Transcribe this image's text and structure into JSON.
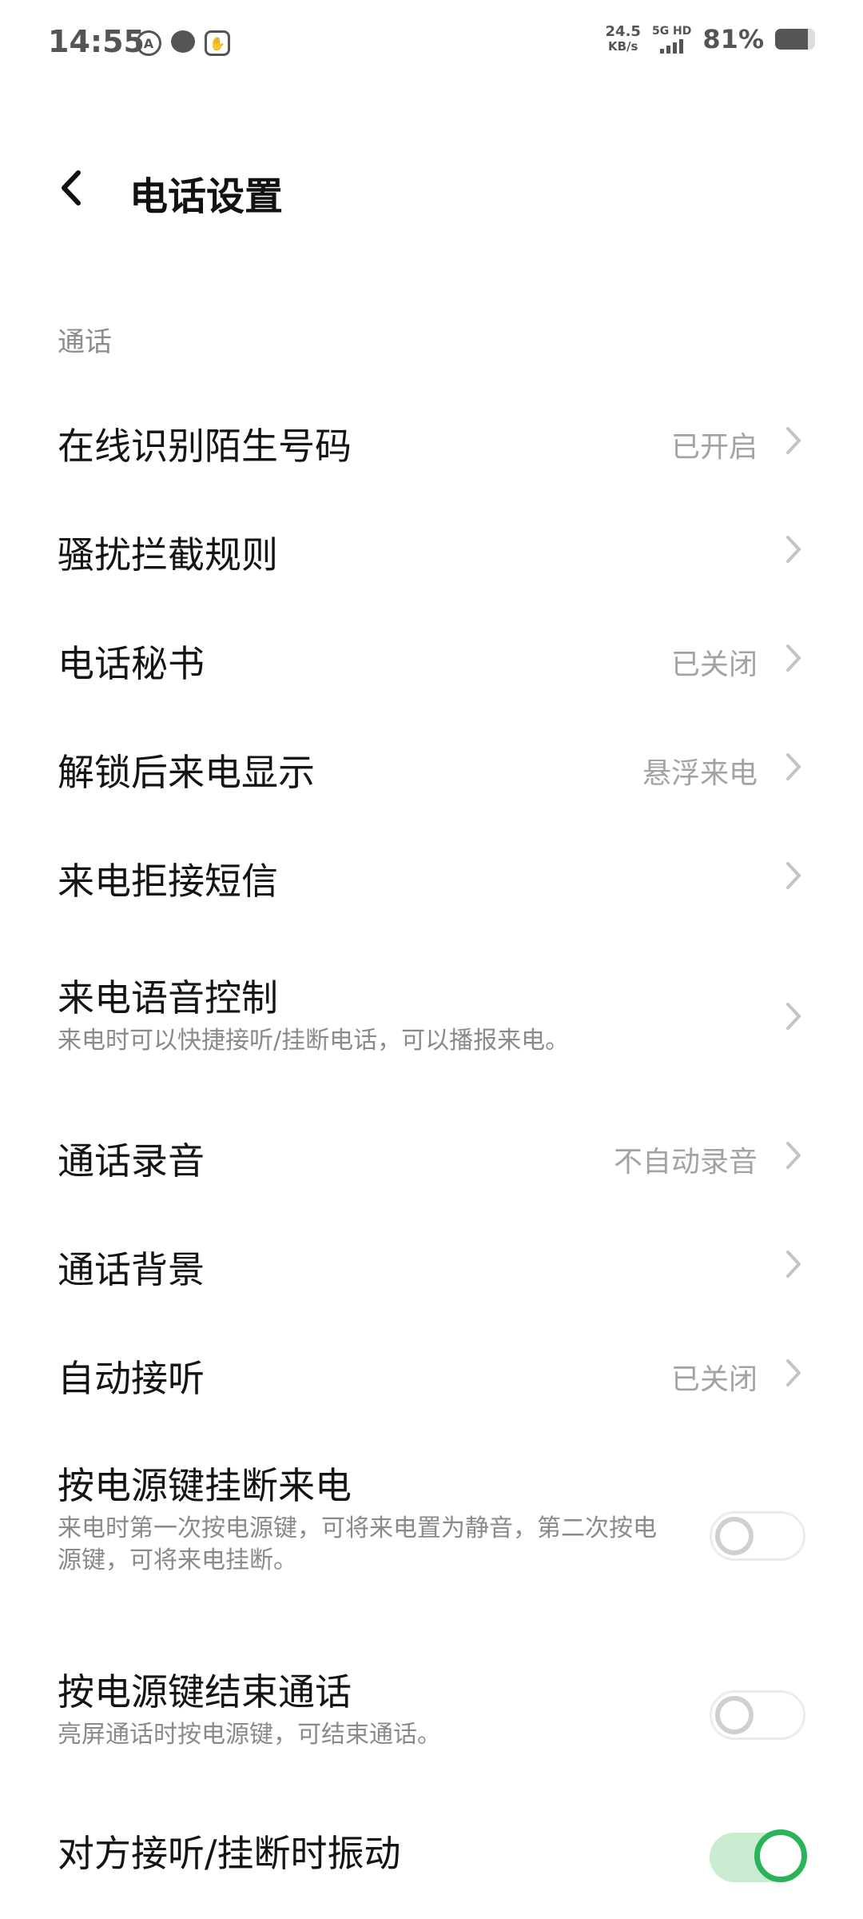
{
  "status_bar": {
    "time": "14:55",
    "left_icons": [
      "accessibility-icon",
      "message-icon",
      "app-icon"
    ],
    "netspeed_value": "24.5",
    "netspeed_unit": "KB/s",
    "network_type": "5G HD",
    "battery_percent_text": "81%",
    "battery_level": 0.81
  },
  "header": {
    "title": "电话设置",
    "back_icon": "chevron-left-icon"
  },
  "section": {
    "label": "通话"
  },
  "rows": [
    {
      "title": "在线识别陌生号码",
      "value": "已开启",
      "type": "nav"
    },
    {
      "title": "骚扰拦截规则",
      "value": "",
      "type": "nav"
    },
    {
      "title": "电话秘书",
      "value": "已关闭",
      "type": "nav"
    },
    {
      "title": "解锁后来电显示",
      "value": "悬浮来电",
      "type": "nav"
    },
    {
      "title": "来电拒接短信",
      "value": "",
      "type": "nav"
    },
    {
      "title": "来电语音控制",
      "subtitle": "来电时可以快捷接听/挂断电话，可以播报来电。",
      "type": "nav"
    },
    {
      "title": "通话录音",
      "value": "不自动录音",
      "type": "nav"
    },
    {
      "title": "通话背景",
      "value": "",
      "type": "nav"
    },
    {
      "title": "自动接听",
      "value": "已关闭",
      "type": "nav"
    },
    {
      "title": "按电源键挂断来电",
      "subtitle": "来电时第一次按电源键，可将来电置为静音，第二次按电源键，可将来电挂断。",
      "type": "toggle",
      "on": false
    },
    {
      "title": "按电源键结束通话",
      "subtitle": "亮屏通话时按电源键，可结束通话。",
      "type": "toggle",
      "on": false
    },
    {
      "title": "对方接听/挂断时振动",
      "type": "toggle",
      "on": true
    }
  ],
  "colors": {
    "accent_green": "#2bb35a",
    "secondary_text": "#a3a3a3"
  }
}
